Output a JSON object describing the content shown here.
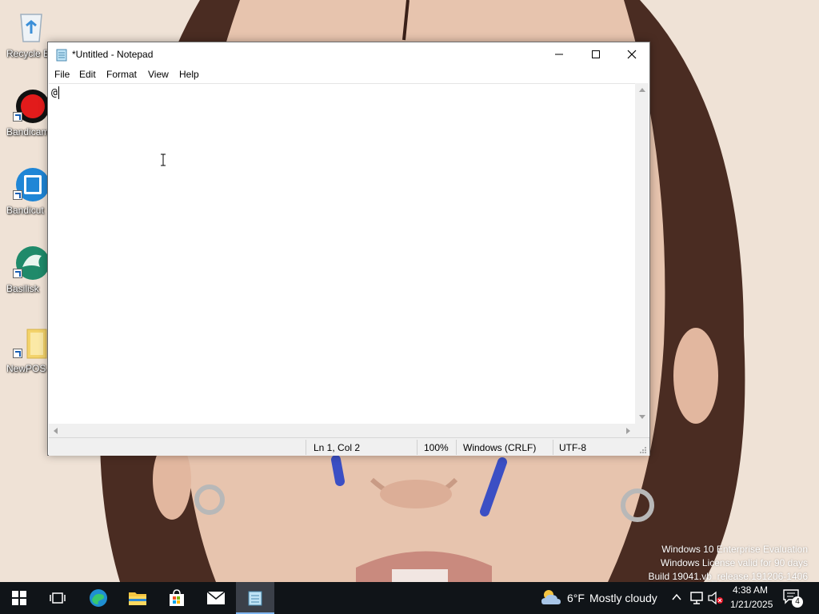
{
  "desktop": {
    "icons": [
      {
        "label": "Recycle Bin",
        "name": "recycle-bin-icon"
      },
      {
        "label": "Bandicam",
        "name": "bandicam-icon"
      },
      {
        "label": "Bandicut",
        "name": "bandicut-icon"
      },
      {
        "label": "Basilisk",
        "name": "basilisk-icon"
      },
      {
        "label": "NewPOS",
        "name": "folder-icon"
      }
    ],
    "watermark": {
      "line1": "Windows 10 Enterprise Evaluation",
      "line2": "Windows License valid for 90 days",
      "line3": "Build 19041.vb_release.191206-1406"
    }
  },
  "notepad": {
    "title": "*Untitled - Notepad",
    "menu": [
      "File",
      "Edit",
      "Format",
      "View",
      "Help"
    ],
    "content": "@",
    "status": {
      "position": "Ln 1, Col 2",
      "zoom": "100%",
      "line_ending": "Windows (CRLF)",
      "encoding": "UTF-8"
    }
  },
  "taskbar": {
    "weather_temp": "6°F",
    "weather_desc": "Mostly cloudy",
    "time": "4:38 AM",
    "date": "1/21/2025",
    "notification_count": "4",
    "accent": "#7fb6f0",
    "background": "#101418"
  }
}
